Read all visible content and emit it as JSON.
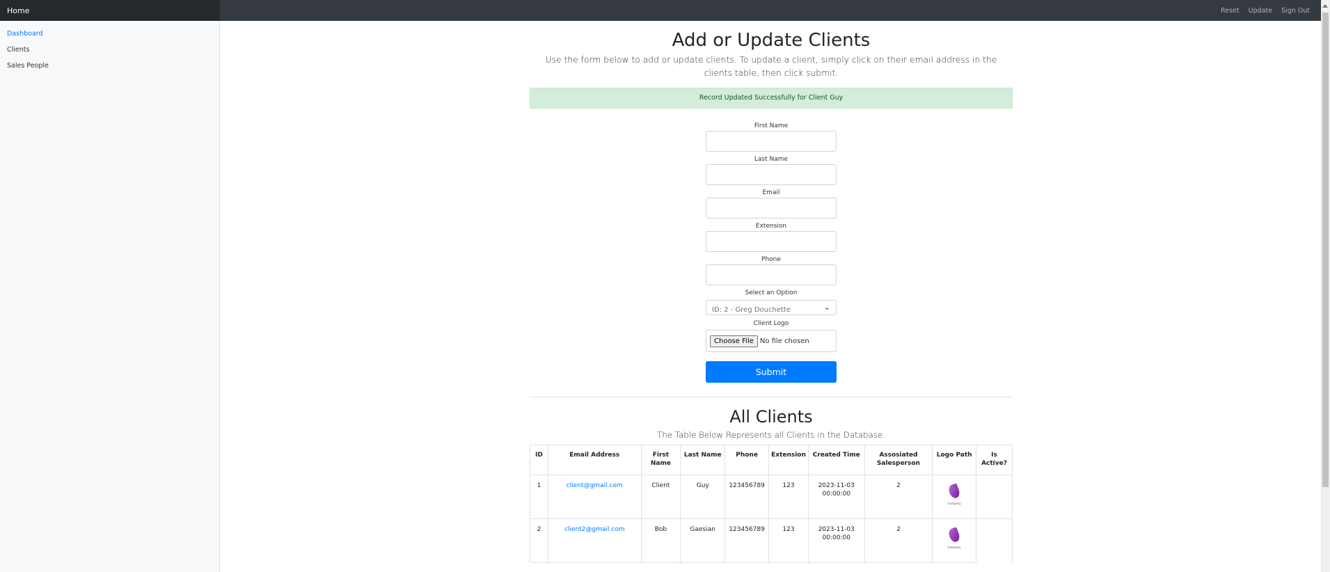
{
  "navbar": {
    "brand": "Home",
    "links": [
      "Reset",
      "Update",
      "Sign Out"
    ]
  },
  "sidebar": {
    "items": [
      {
        "label": "Dashboard",
        "active": true
      },
      {
        "label": "Clients",
        "active": false
      },
      {
        "label": "Sales People",
        "active": false
      }
    ]
  },
  "main": {
    "title": "Add or Update Clients",
    "lead": "Use the form below to add or update clients. To update a client, simply click on their email address in the clients table, then click submit.",
    "alert": "Record Updated Successfully for Client Guy",
    "alert_color": "#d4edda"
  },
  "form": {
    "first_name_label": "First Name",
    "first_name_value": "",
    "last_name_label": "Last Name",
    "last_name_value": "",
    "email_label": "Email",
    "email_value": "",
    "extension_label": "Extension",
    "extension_value": "",
    "phone_label": "Phone",
    "phone_value": "",
    "select_label": "Select an Option",
    "select_value": "ID: 2 - Greg Douchette",
    "logo_label": "Client Logo",
    "file_button": "Choose File",
    "file_status": "No file chosen",
    "submit_label": "Submit",
    "accent_color": "#007bff"
  },
  "clients": {
    "title": "All Clients",
    "lead": "The Table Below Represents all Clients in the Database.",
    "columns": [
      "ID",
      "Email Address",
      "First Name",
      "Last Name",
      "Phone",
      "Extension",
      "Created Time",
      "Assosiated Salesperson",
      "Logo Path",
      "Is Active?"
    ],
    "rows": [
      {
        "id": "1",
        "email": "client@gmail.com",
        "first": "Client",
        "last": "Guy",
        "phone": "123456789",
        "ext": "123",
        "created": "2023-11-03 00:00:00",
        "salesperson": "2",
        "logo": "logo-image",
        "active": ""
      },
      {
        "id": "2",
        "email": "client2@gmail.com",
        "first": "Bob",
        "last": "Gaesian",
        "phone": "123456789",
        "ext": "123",
        "created": "2023-11-03 00:00:00",
        "salesperson": "2",
        "logo": "logo-image",
        "active": ""
      }
    ]
  }
}
